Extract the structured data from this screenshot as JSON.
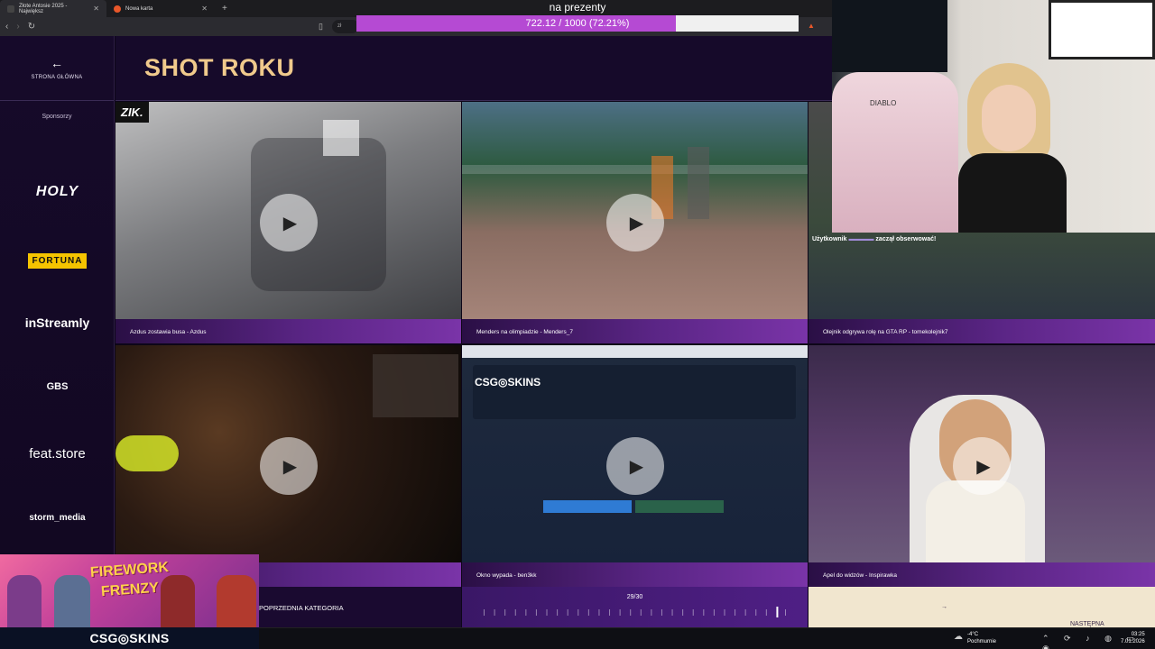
{
  "browser": {
    "tabs": [
      {
        "title": "Złote Antosie 2025 - Największ",
        "active": true
      },
      {
        "title": "Nowa karta",
        "active": false
      }
    ],
    "new_tab": "+",
    "url_fragment": "zł"
  },
  "donation_goal": {
    "title": "na prezenty",
    "current": 722.12,
    "target": 1000,
    "text": "722.12 / 1000 (72.21%)",
    "fraction": 0.7221,
    "fill_color": "#b54ad3"
  },
  "sidebar": {
    "home_label": "STRONA GŁÓWNA",
    "sponsors_label": "Sponsorzy",
    "sponsors": [
      "HOLY",
      "FORTUNA",
      "inStreamly",
      "GBS",
      "feat.store",
      "storm_media"
    ]
  },
  "page": {
    "title": "SHOT ROKU"
  },
  "clips": [
    {
      "label": "Azdus zostawia busa - Azdus",
      "badge": "ZIK."
    },
    {
      "label": "Menders na olimpiadzie - Menders_7"
    },
    {
      "label": "Olejnik odgrywa rolę na GTA RP - tomekolejnik7"
    },
    {
      "label": ""
    },
    {
      "label": "Okno wypada - ben3kk",
      "logo": "CSG◎SKINS"
    },
    {
      "label": "Apel do widzów - Inspirawka"
    }
  ],
  "pagination": {
    "prev": "POPRZEDNIA KATEGORIA",
    "current": "29/30",
    "current_index": 29,
    "total": 30,
    "next": "NASTĘPNA KATEGORIA"
  },
  "overlay": {
    "follow_user": "Użytkownik",
    "follow_text": "zaczął obserwować!",
    "banner_title1": "FIREWORK",
    "banner_title2": "FRENZY",
    "brand": "CSG◎SKINS",
    "chair_logo": "DIABLO"
  },
  "taskbar": {
    "temperature": "-4°C",
    "weather": "Pochmurnie",
    "time": "03:25",
    "date": "7.01.2026"
  },
  "colors": {
    "accent_gold": "#f0ca8c",
    "purple": "#5a2585",
    "cream": "#f1e6cf"
  }
}
